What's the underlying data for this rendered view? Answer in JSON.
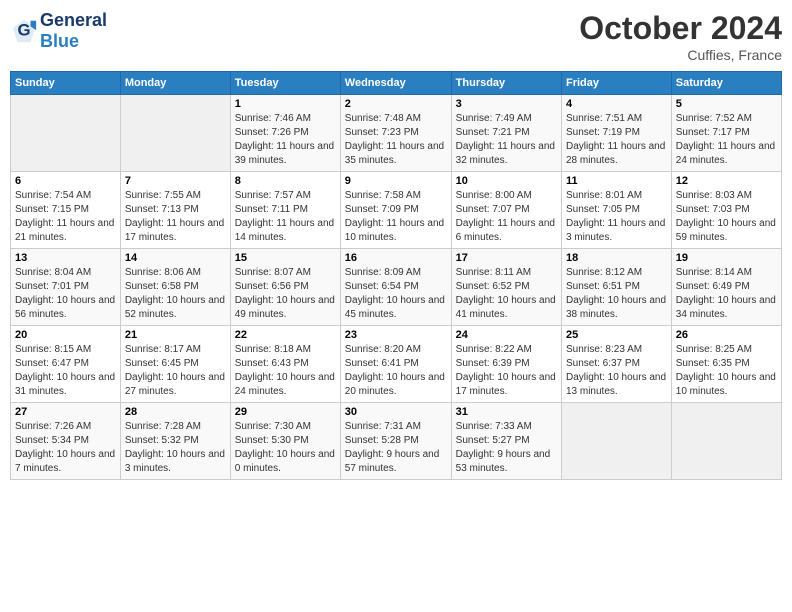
{
  "header": {
    "logo_general": "General",
    "logo_blue": "Blue",
    "month": "October 2024",
    "location": "Cuffies, France"
  },
  "weekdays": [
    "Sunday",
    "Monday",
    "Tuesday",
    "Wednesday",
    "Thursday",
    "Friday",
    "Saturday"
  ],
  "weeks": [
    [
      {
        "day": "",
        "text": ""
      },
      {
        "day": "",
        "text": ""
      },
      {
        "day": "1",
        "text": "Sunrise: 7:46 AM\nSunset: 7:26 PM\nDaylight: 11 hours and 39 minutes."
      },
      {
        "day": "2",
        "text": "Sunrise: 7:48 AM\nSunset: 7:23 PM\nDaylight: 11 hours and 35 minutes."
      },
      {
        "day": "3",
        "text": "Sunrise: 7:49 AM\nSunset: 7:21 PM\nDaylight: 11 hours and 32 minutes."
      },
      {
        "day": "4",
        "text": "Sunrise: 7:51 AM\nSunset: 7:19 PM\nDaylight: 11 hours and 28 minutes."
      },
      {
        "day": "5",
        "text": "Sunrise: 7:52 AM\nSunset: 7:17 PM\nDaylight: 11 hours and 24 minutes."
      }
    ],
    [
      {
        "day": "6",
        "text": "Sunrise: 7:54 AM\nSunset: 7:15 PM\nDaylight: 11 hours and 21 minutes."
      },
      {
        "day": "7",
        "text": "Sunrise: 7:55 AM\nSunset: 7:13 PM\nDaylight: 11 hours and 17 minutes."
      },
      {
        "day": "8",
        "text": "Sunrise: 7:57 AM\nSunset: 7:11 PM\nDaylight: 11 hours and 14 minutes."
      },
      {
        "day": "9",
        "text": "Sunrise: 7:58 AM\nSunset: 7:09 PM\nDaylight: 11 hours and 10 minutes."
      },
      {
        "day": "10",
        "text": "Sunrise: 8:00 AM\nSunset: 7:07 PM\nDaylight: 11 hours and 6 minutes."
      },
      {
        "day": "11",
        "text": "Sunrise: 8:01 AM\nSunset: 7:05 PM\nDaylight: 11 hours and 3 minutes."
      },
      {
        "day": "12",
        "text": "Sunrise: 8:03 AM\nSunset: 7:03 PM\nDaylight: 10 hours and 59 minutes."
      }
    ],
    [
      {
        "day": "13",
        "text": "Sunrise: 8:04 AM\nSunset: 7:01 PM\nDaylight: 10 hours and 56 minutes."
      },
      {
        "day": "14",
        "text": "Sunrise: 8:06 AM\nSunset: 6:58 PM\nDaylight: 10 hours and 52 minutes."
      },
      {
        "day": "15",
        "text": "Sunrise: 8:07 AM\nSunset: 6:56 PM\nDaylight: 10 hours and 49 minutes."
      },
      {
        "day": "16",
        "text": "Sunrise: 8:09 AM\nSunset: 6:54 PM\nDaylight: 10 hours and 45 minutes."
      },
      {
        "day": "17",
        "text": "Sunrise: 8:11 AM\nSunset: 6:52 PM\nDaylight: 10 hours and 41 minutes."
      },
      {
        "day": "18",
        "text": "Sunrise: 8:12 AM\nSunset: 6:51 PM\nDaylight: 10 hours and 38 minutes."
      },
      {
        "day": "19",
        "text": "Sunrise: 8:14 AM\nSunset: 6:49 PM\nDaylight: 10 hours and 34 minutes."
      }
    ],
    [
      {
        "day": "20",
        "text": "Sunrise: 8:15 AM\nSunset: 6:47 PM\nDaylight: 10 hours and 31 minutes."
      },
      {
        "day": "21",
        "text": "Sunrise: 8:17 AM\nSunset: 6:45 PM\nDaylight: 10 hours and 27 minutes."
      },
      {
        "day": "22",
        "text": "Sunrise: 8:18 AM\nSunset: 6:43 PM\nDaylight: 10 hours and 24 minutes."
      },
      {
        "day": "23",
        "text": "Sunrise: 8:20 AM\nSunset: 6:41 PM\nDaylight: 10 hours and 20 minutes."
      },
      {
        "day": "24",
        "text": "Sunrise: 8:22 AM\nSunset: 6:39 PM\nDaylight: 10 hours and 17 minutes."
      },
      {
        "day": "25",
        "text": "Sunrise: 8:23 AM\nSunset: 6:37 PM\nDaylight: 10 hours and 13 minutes."
      },
      {
        "day": "26",
        "text": "Sunrise: 8:25 AM\nSunset: 6:35 PM\nDaylight: 10 hours and 10 minutes."
      }
    ],
    [
      {
        "day": "27",
        "text": "Sunrise: 7:26 AM\nSunset: 5:34 PM\nDaylight: 10 hours and 7 minutes."
      },
      {
        "day": "28",
        "text": "Sunrise: 7:28 AM\nSunset: 5:32 PM\nDaylight: 10 hours and 3 minutes."
      },
      {
        "day": "29",
        "text": "Sunrise: 7:30 AM\nSunset: 5:30 PM\nDaylight: 10 hours and 0 minutes."
      },
      {
        "day": "30",
        "text": "Sunrise: 7:31 AM\nSunset: 5:28 PM\nDaylight: 9 hours and 57 minutes."
      },
      {
        "day": "31",
        "text": "Sunrise: 7:33 AM\nSunset: 5:27 PM\nDaylight: 9 hours and 53 minutes."
      },
      {
        "day": "",
        "text": ""
      },
      {
        "day": "",
        "text": ""
      }
    ]
  ]
}
